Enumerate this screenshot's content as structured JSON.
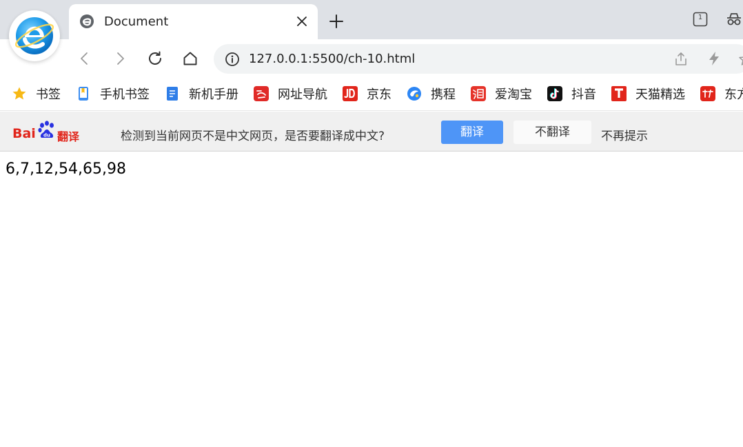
{
  "browser": {
    "tab": {
      "title": "Document",
      "favicon": "document-favicon-icon"
    },
    "tab_count": "1",
    "address": {
      "url": "127.0.0.1:5500/ch-10.html"
    }
  },
  "bookmarks": [
    {
      "label": "书签",
      "icon": "star-icon"
    },
    {
      "label": "手机书签",
      "icon": "phone-bookmark-icon"
    },
    {
      "label": "新机手册",
      "icon": "manual-icon"
    },
    {
      "label": "网址导航",
      "icon": "nav-icon"
    },
    {
      "label": "京东",
      "icon": "jd-icon"
    },
    {
      "label": "携程",
      "icon": "ctrip-icon"
    },
    {
      "label": "爱淘宝",
      "icon": "taobao-icon"
    },
    {
      "label": "抖音",
      "icon": "douyin-icon"
    },
    {
      "label": "天猫精选",
      "icon": "tmall-icon"
    },
    {
      "label": "东方",
      "icon": "dongfang-icon"
    }
  ],
  "translate_bar": {
    "logo_text": "Bai",
    "logo_suffix": "翻译",
    "message": "检测到当前网页不是中文网页，是否要翻译成中文?",
    "translate_label": "翻译",
    "no_translate_label": "不翻译",
    "no_prompt_label": "不再提示"
  },
  "page": {
    "output": "6,7,12,54,65,98"
  },
  "colors": {
    "tabstrip": "#dee1e6",
    "translate_button": "#4e95f7",
    "baidu_red": "#e1251b"
  }
}
